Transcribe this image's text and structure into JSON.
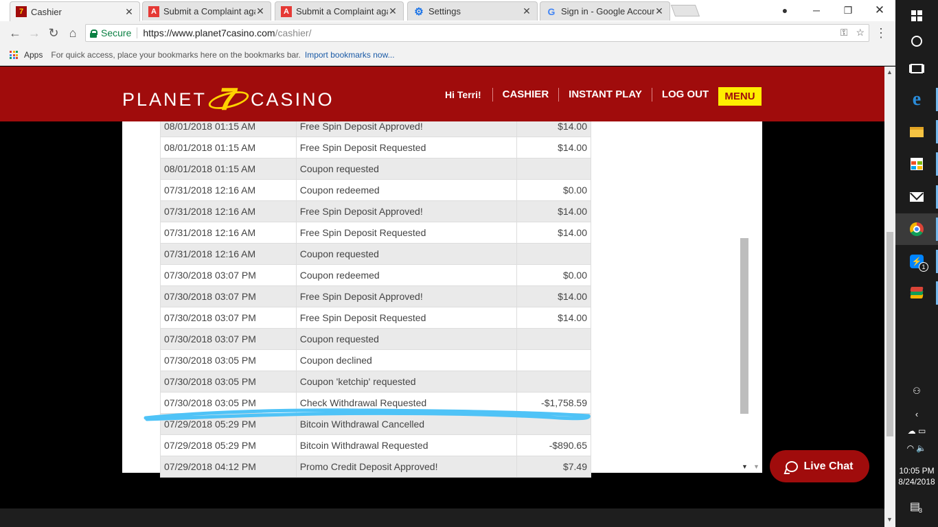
{
  "browser": {
    "tabs": [
      {
        "title": "Cashier",
        "favicon": "planet7-icon",
        "active": true
      },
      {
        "title": "Submit a Complaint again",
        "favicon": "a-icon",
        "active": false
      },
      {
        "title": "Submit a Complaint again",
        "favicon": "a-icon",
        "active": false
      },
      {
        "title": "Settings",
        "favicon": "gear-icon",
        "active": false
      },
      {
        "title": "Sign in - Google Accounts",
        "favicon": "google-icon",
        "active": false
      }
    ],
    "address": {
      "secure_label": "Secure",
      "url_host": "https://www.planet7casino.com",
      "url_path": "/cashier/"
    },
    "bookmarks": {
      "apps_label": "Apps",
      "hint": "For quick access, place your bookmarks here on the bookmarks bar.",
      "import_link": "Import bookmarks now..."
    }
  },
  "site": {
    "logo": {
      "left": "PLANET",
      "seven": "7",
      "right": "CASINO"
    },
    "greeting": "Hi Terri!",
    "nav": [
      "CASHIER",
      "INSTANT PLAY",
      "LOG OUT"
    ],
    "menu_label": "MENU",
    "live_chat_label": "Live Chat"
  },
  "transactions": [
    {
      "date": "08/01/2018 01:15 AM",
      "desc": "Free Spin Deposit Approved!",
      "amount": "$14.00"
    },
    {
      "date": "08/01/2018 01:15 AM",
      "desc": "Free Spin Deposit Requested",
      "amount": "$14.00"
    },
    {
      "date": "08/01/2018 01:15 AM",
      "desc": "Coupon requested",
      "amount": ""
    },
    {
      "date": "07/31/2018 12:16 AM",
      "desc": "Coupon redeemed",
      "amount": "$0.00"
    },
    {
      "date": "07/31/2018 12:16 AM",
      "desc": "Free Spin Deposit Approved!",
      "amount": "$14.00"
    },
    {
      "date": "07/31/2018 12:16 AM",
      "desc": "Free Spin Deposit Requested",
      "amount": "$14.00"
    },
    {
      "date": "07/31/2018 12:16 AM",
      "desc": "Coupon requested",
      "amount": ""
    },
    {
      "date": "07/30/2018 03:07 PM",
      "desc": "Coupon redeemed",
      "amount": "$0.00"
    },
    {
      "date": "07/30/2018 03:07 PM",
      "desc": "Free Spin Deposit Approved!",
      "amount": "$14.00"
    },
    {
      "date": "07/30/2018 03:07 PM",
      "desc": "Free Spin Deposit Requested",
      "amount": "$14.00"
    },
    {
      "date": "07/30/2018 03:07 PM",
      "desc": "Coupon requested",
      "amount": ""
    },
    {
      "date": "07/30/2018 03:05 PM",
      "desc": "Coupon declined",
      "amount": ""
    },
    {
      "date": "07/30/2018 03:05 PM",
      "desc": "Coupon 'ketchip' requested",
      "amount": ""
    },
    {
      "date": "07/30/2018 03:05 PM",
      "desc": "Check Withdrawal Requested",
      "amount": "-$1,758.59"
    },
    {
      "date": "07/29/2018 05:29 PM",
      "desc": "Bitcoin Withdrawal Cancelled",
      "amount": ""
    },
    {
      "date": "07/29/2018 05:29 PM",
      "desc": "Bitcoin Withdrawal Requested",
      "amount": "-$890.65"
    },
    {
      "date": "07/29/2018 04:12 PM",
      "desc": "Promo Credit Deposit Approved!",
      "amount": "$7.49"
    }
  ],
  "taskbar": {
    "messenger_badge": "1",
    "time": "10:05 PM",
    "date": "8/24/2018",
    "notifications_count": "3"
  },
  "colors": {
    "brand_red": "#a00c0c",
    "brand_yellow": "#ffd200",
    "menu_yellow": "#ffee00",
    "highlight_stroke": "#4fc3f7",
    "secure_green": "#0b8043"
  }
}
